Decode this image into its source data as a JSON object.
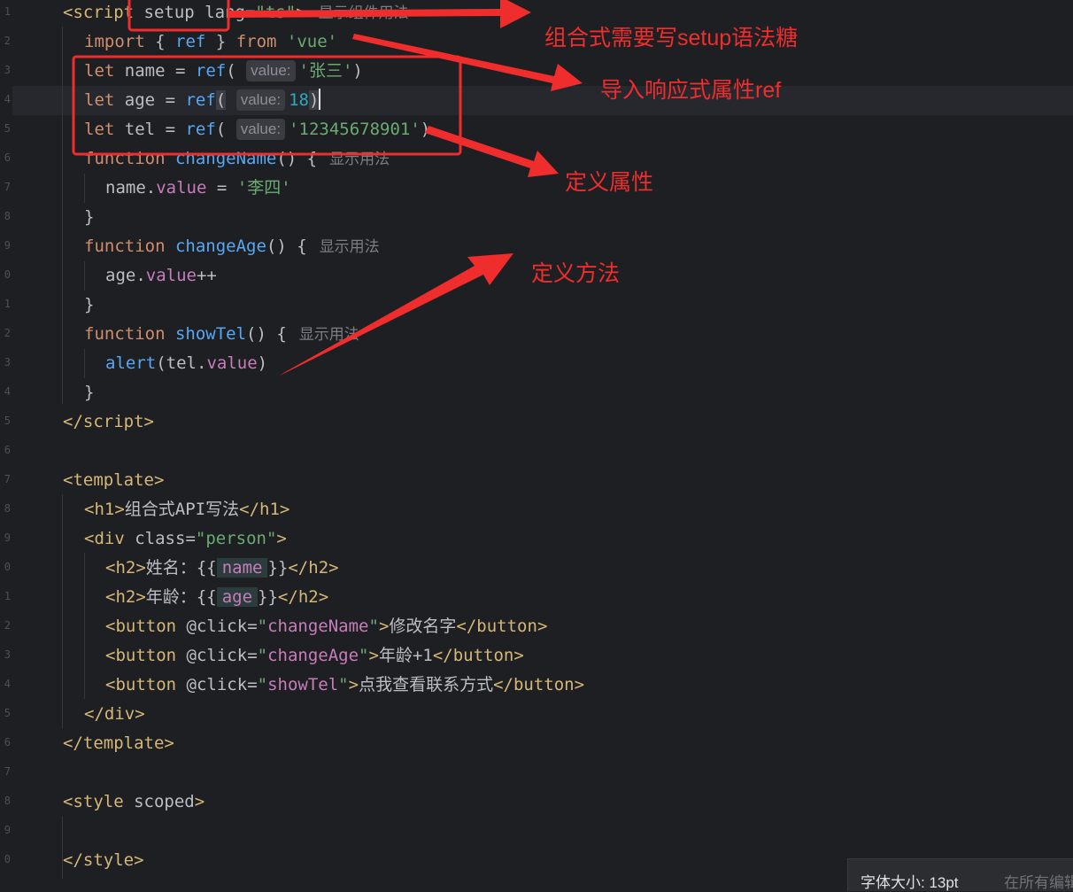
{
  "editor": {
    "line_numbers": [
      "1",
      "2",
      "3",
      "4",
      "5",
      "6",
      "7",
      "8",
      "9",
      "0",
      "1",
      "2",
      "3",
      "4",
      "5",
      "6",
      "7",
      "8",
      "9",
      "0",
      "1",
      "2",
      "3",
      "4",
      "5",
      "6",
      "7",
      "8",
      "9",
      "0"
    ],
    "hint_label": "value:",
    "usage_label": "显示用法",
    "usage_label_component": "显示组件用法",
    "script_open": {
      "lt": "<",
      "tag": "script",
      "attr_setup": "setup",
      "attr_lang": "lang",
      "eq": "=",
      "lang_value": "\"ts\"",
      "gt": ">"
    },
    "import_line": {
      "kw": "import",
      "open": "{",
      "name": "ref",
      "close": "}",
      "from": "from",
      "module": "'vue'"
    },
    "let_name": {
      "kw": "let",
      "var": "name",
      "eq": "=",
      "fn": "ref",
      "open": "(",
      "value": "'张三'",
      "close": ")"
    },
    "let_age": {
      "kw": "let",
      "var": "age",
      "eq": "=",
      "fn": "ref",
      "open": "(",
      "value": "18",
      "close": ")"
    },
    "let_tel": {
      "kw": "let",
      "var": "tel",
      "eq": "=",
      "fn": "ref",
      "open": "(",
      "value": "'12345678901'",
      "close": ")"
    },
    "fn_change_name": {
      "kw": "function",
      "name": "changeName",
      "sig": "() {",
      "body_obj": "name",
      "body_dot": ".",
      "body_prop": "value",
      "body_eq": " = ",
      "body_val": "'李四'"
    },
    "fn_change_age": {
      "kw": "function",
      "name": "changeAge",
      "sig": "() {",
      "body_obj": "age",
      "body_dot": ".",
      "body_prop": "value",
      "body_op": "++"
    },
    "fn_show_tel": {
      "kw": "function",
      "name": "showTel",
      "sig": "() {",
      "body_fn": "alert",
      "body_open": "(",
      "body_obj": "tel",
      "body_dot": ".",
      "body_prop": "value",
      "body_close": ")"
    },
    "close_brace": "}",
    "script_close": {
      "lt": "</",
      "tag": "script",
      "gt": ">"
    },
    "template_open": {
      "lt": "<",
      "tag": "template",
      "gt": ">"
    },
    "h1": {
      "lt": "<",
      "tag": "h1",
      "gt": ">",
      "text": "组合式API写法",
      "close_lt": "</",
      "close_tag": "h1",
      "close_gt": ">"
    },
    "div_open": {
      "lt": "<",
      "tag": "div",
      "attr": "class",
      "eq": "=",
      "value": "\"person\"",
      "gt": ">"
    },
    "h2_name": {
      "lt": "<",
      "tag": "h2",
      "gt": ">",
      "text": "姓名：",
      "mustache_open": "{{",
      "expr": "name",
      "mustache_close": "}}",
      "close_lt": "</",
      "close_tag": "h2",
      "close_gt": ">"
    },
    "h2_age": {
      "lt": "<",
      "tag": "h2",
      "gt": ">",
      "text": "年龄：",
      "mustache_open": "{{",
      "expr": "age",
      "mustache_close": "}}",
      "close_lt": "</",
      "close_tag": "h2",
      "close_gt": ">"
    },
    "btn_name": {
      "lt": "<",
      "tag": "button",
      "attr": "@click",
      "eq": "=",
      "q1": "\"",
      "handler": "changeName",
      "q2": "\"",
      "gt": ">",
      "text": "修改名字",
      "close_lt": "</",
      "close_tag": "button",
      "close_gt": ">"
    },
    "btn_age": {
      "lt": "<",
      "tag": "button",
      "attr": "@click",
      "eq": "=",
      "q1": "\"",
      "handler": "changeAge",
      "q2": "\"",
      "gt": ">",
      "text": "年龄+1",
      "close_lt": "</",
      "close_tag": "button",
      "close_gt": ">"
    },
    "btn_tel": {
      "lt": "<",
      "tag": "button",
      "attr": "@click",
      "eq": "=",
      "q1": "\"",
      "handler": "showTel",
      "q2": "\"",
      "gt": ">",
      "text": "点我查看联系方式",
      "close_lt": "</",
      "close_tag": "button",
      "close_gt": ">"
    },
    "div_close": {
      "lt": "</",
      "tag": "div",
      "gt": ">"
    },
    "template_close": {
      "lt": "</",
      "tag": "template",
      "gt": ">"
    },
    "style_open": {
      "lt": "<",
      "tag": "style",
      "attr": "scoped",
      "gt": ">"
    },
    "style_close": {
      "lt": "</",
      "tag": "style",
      "gt": ">"
    }
  },
  "annotations": {
    "setup_note": "组合式需要写setup语法糖",
    "ref_note": "导入响应式属性ref",
    "props_note": "定义属性",
    "methods_note": "定义方法",
    "color": "#f02d2d"
  },
  "status_bar": {
    "font_size": "字体大小: 13pt",
    "scope_partial": "在所有编辑"
  }
}
